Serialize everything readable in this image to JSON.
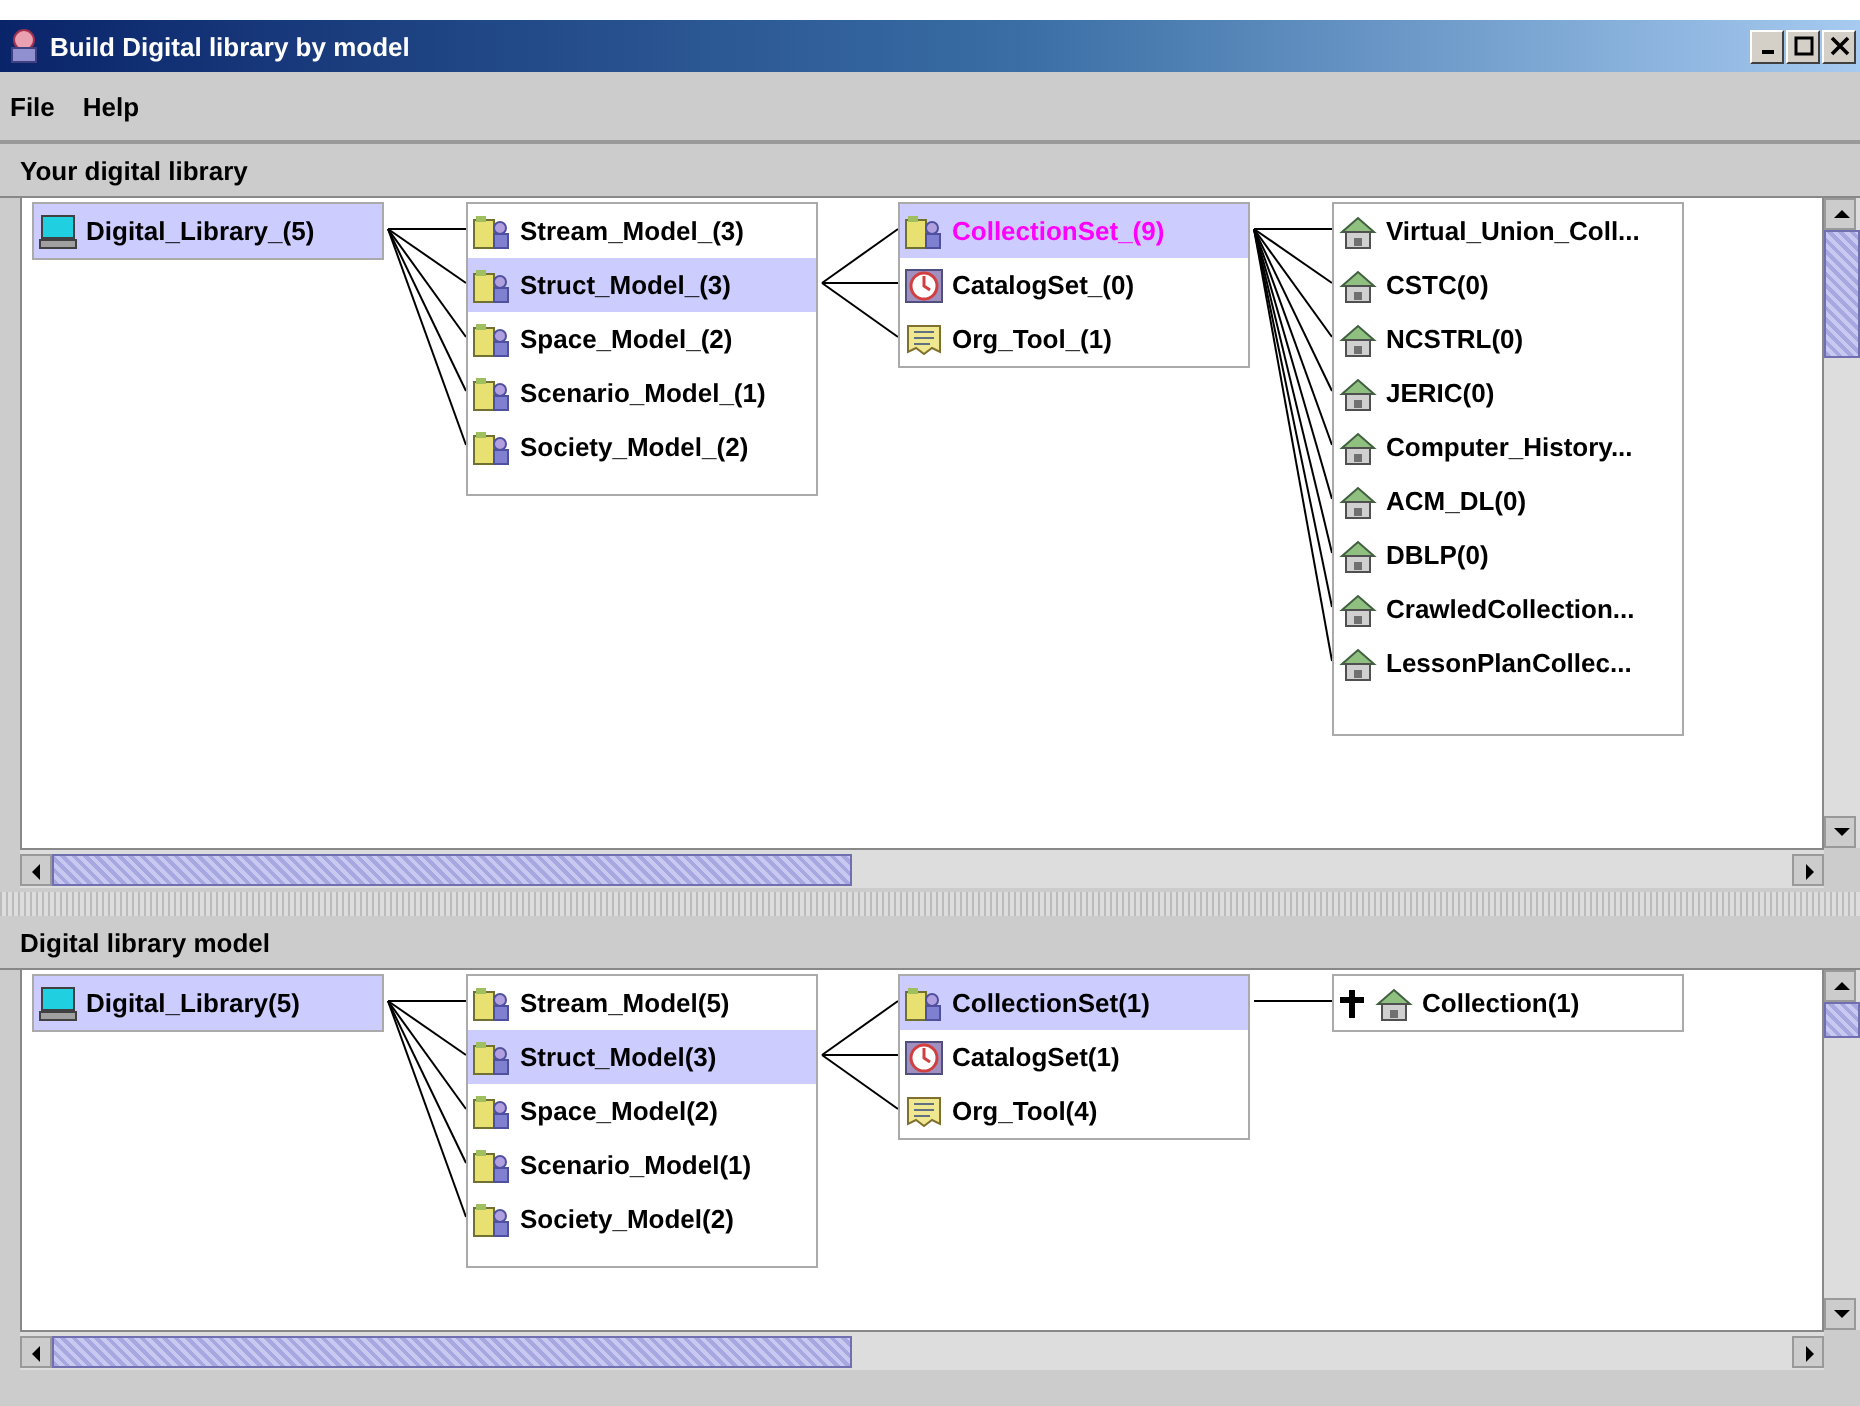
{
  "window": {
    "title": "Build Digital library by model"
  },
  "menu": [
    "File",
    "Help"
  ],
  "panels": [
    {
      "title": "Your digital library",
      "columns": [
        {
          "items": [
            {
              "label": "Digital_Library_(5)",
              "kind": "computer",
              "selected": true
            }
          ]
        },
        {
          "items": [
            {
              "label": "Stream_Model_(3)",
              "kind": "model",
              "selected": false
            },
            {
              "label": "Struct_Model_(3)",
              "kind": "model",
              "selected": true
            },
            {
              "label": "Space_Model_(2)",
              "kind": "model",
              "selected": false
            },
            {
              "label": "Scenario_Model_(1)",
              "kind": "model",
              "selected": false
            },
            {
              "label": "Society_Model_(2)",
              "kind": "model",
              "selected": false
            }
          ]
        },
        {
          "items": [
            {
              "label": "CollectionSet_(9)",
              "kind": "model",
              "selected": true,
              "marked": true
            },
            {
              "label": "CatalogSet_(0)",
              "kind": "catalog",
              "selected": false,
              "marked": false
            },
            {
              "label": "Org_Tool_(1)",
              "kind": "tool",
              "selected": false,
              "marked": false
            }
          ]
        },
        {
          "items": [
            {
              "label": "Virtual_Union_Coll...",
              "kind": "collection",
              "selected": false,
              "expandable": false
            },
            {
              "label": "CSTC(0)",
              "kind": "collection",
              "selected": false,
              "expandable": false
            },
            {
              "label": "NCSTRL(0)",
              "kind": "collection",
              "selected": false,
              "expandable": false
            },
            {
              "label": "JERIC(0)",
              "kind": "collection",
              "selected": false,
              "expandable": false
            },
            {
              "label": "Computer_History...",
              "kind": "collection",
              "selected": false,
              "expandable": false
            },
            {
              "label": "ACM_DL(0)",
              "kind": "collection",
              "selected": false,
              "expandable": false
            },
            {
              "label": "DBLP(0)",
              "kind": "collection",
              "selected": false,
              "expandable": false
            },
            {
              "label": "CrawledCollection...",
              "kind": "collection",
              "selected": false,
              "expandable": false
            },
            {
              "label": "LessonPlanCollec...",
              "kind": "collection",
              "selected": false,
              "expandable": false
            }
          ]
        }
      ]
    },
    {
      "title": "Digital library model",
      "columns": [
        {
          "items": [
            {
              "label": "Digital_Library(5)",
              "kind": "computer",
              "selected": true
            }
          ]
        },
        {
          "items": [
            {
              "label": "Stream_Model(5)",
              "kind": "model",
              "selected": false
            },
            {
              "label": "Struct_Model(3)",
              "kind": "model",
              "selected": true
            },
            {
              "label": "Space_Model(2)",
              "kind": "model",
              "selected": false
            },
            {
              "label": "Scenario_Model(1)",
              "kind": "model",
              "selected": false
            },
            {
              "label": "Society_Model(2)",
              "kind": "model",
              "selected": false
            }
          ]
        },
        {
          "items": [
            {
              "label": "CollectionSet(1)",
              "kind": "model",
              "selected": true,
              "marked": false
            },
            {
              "label": "CatalogSet(1)",
              "kind": "catalog",
              "selected": false,
              "marked": false
            },
            {
              "label": "Org_Tool(4)",
              "kind": "tool",
              "selected": false,
              "marked": false
            }
          ]
        },
        {
          "items": [
            {
              "label": "Collection(1)",
              "kind": "collection",
              "selected": false,
              "expandable": true
            }
          ]
        }
      ]
    }
  ]
}
